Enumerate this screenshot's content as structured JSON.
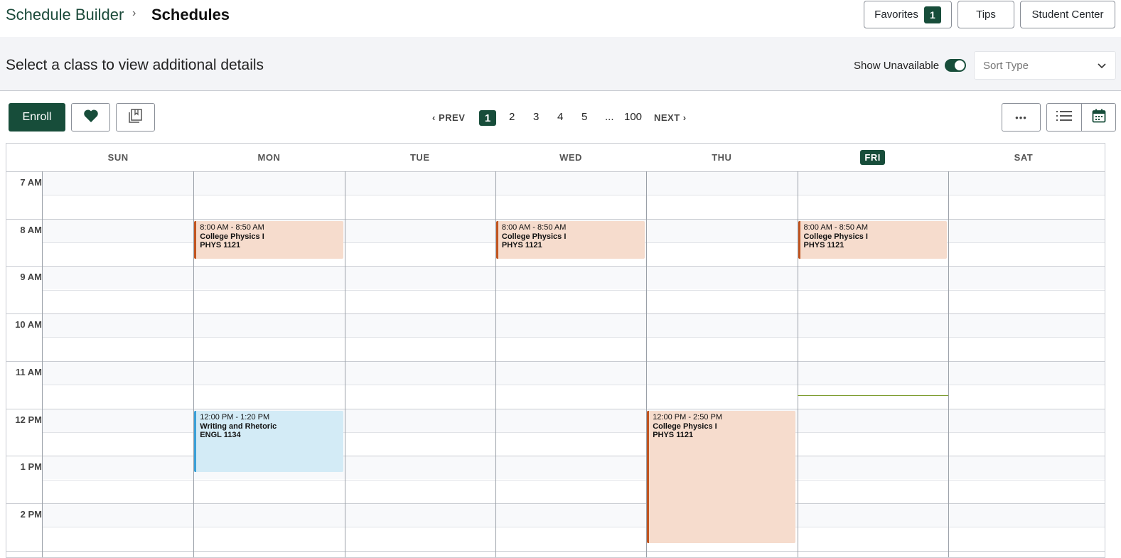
{
  "breadcrumb": {
    "parent": "Schedule Builder",
    "separator": "›",
    "current": "Schedules"
  },
  "header_buttons": {
    "favorites": "Favorites",
    "favorites_count": "1",
    "tips": "Tips",
    "student_center": "Student Center"
  },
  "subheader": {
    "title": "Select a class to view additional details",
    "show_unavailable": "Show Unavailable",
    "sort_placeholder": "Sort Type"
  },
  "toolbar": {
    "enroll": "Enroll",
    "more": "•••"
  },
  "pagination": {
    "prev": "PREV",
    "next": "NEXT",
    "pages": [
      "1",
      "2",
      "3",
      "4",
      "5",
      "...",
      "100"
    ],
    "current": "1"
  },
  "calendar": {
    "days": [
      "SUN",
      "MON",
      "TUE",
      "WED",
      "THU",
      "FRI",
      "SAT"
    ],
    "today": "FRI",
    "times": [
      "7 AM",
      "8 AM",
      "9 AM",
      "10 AM",
      "11 AM",
      "12 PM",
      "1 PM",
      "2 PM"
    ],
    "events": [
      {
        "day": "MON",
        "time": "8:00 AM - 8:50 AM",
        "title": "College Physics I",
        "code": "PHYS 1121",
        "color": "#c0541f"
      },
      {
        "day": "WED",
        "time": "8:00 AM - 8:50 AM",
        "title": "College Physics I",
        "code": "PHYS 1121",
        "color": "#c0541f"
      },
      {
        "day": "FRI",
        "time": "8:00 AM - 8:50 AM",
        "title": "College Physics I",
        "code": "PHYS 1121",
        "color": "#c0541f"
      },
      {
        "day": "MON",
        "time": "12:00 PM - 1:20 PM",
        "title": "Writing and Rhetoric",
        "code": "ENGL 1134",
        "color": "#3a9fd6"
      },
      {
        "day": "THU",
        "time": "12:00 PM - 2:50 PM",
        "title": "College Physics I",
        "code": "PHYS 1121",
        "color": "#c0541f"
      }
    ]
  },
  "colors": {
    "brand": "#174d3a",
    "physics": "#f6dccd",
    "rhetoric": "#d3ebf6"
  }
}
